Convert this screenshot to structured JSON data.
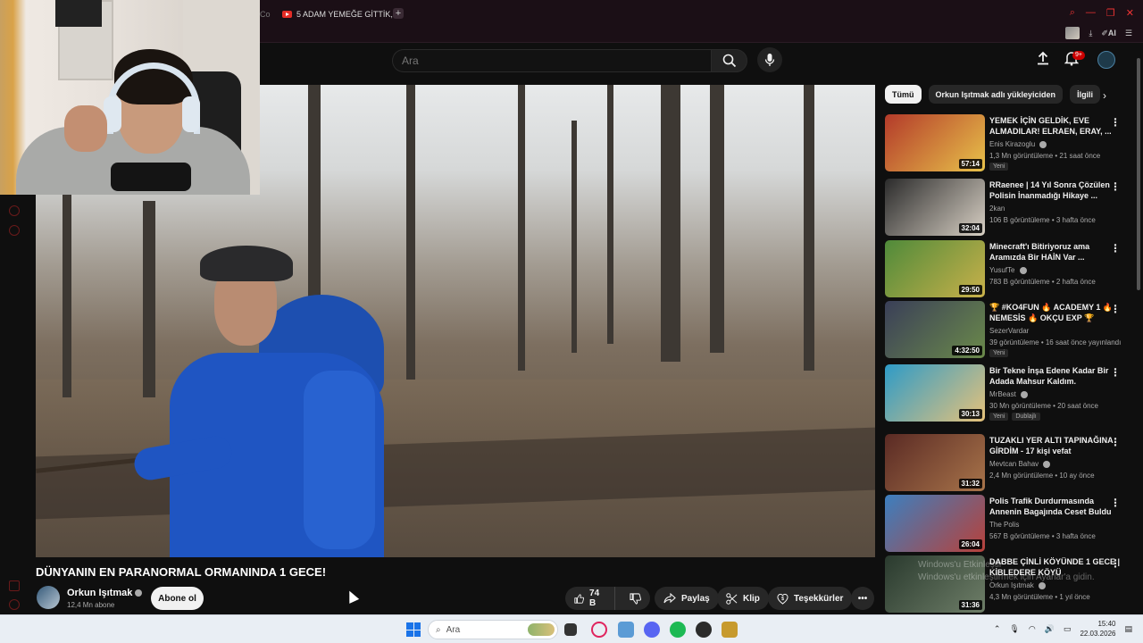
{
  "browser": {
    "tabs": [
      {
        "label": "Co",
        "partial": true
      },
      {
        "label": "5 ADAM YEMEĞE GİTTİK,"
      }
    ],
    "new_tab": "+",
    "toolbar_ai_label": "AI"
  },
  "masthead": {
    "search_placeholder": "Ara",
    "notifications_badge": "9+"
  },
  "video": {
    "title": "DÜNYANIN EN PARANORMAL ORMANINDA 1 GECE!",
    "channel": "Orkun Işıtmak",
    "subscribers": "12,4 Mn abone",
    "subscribe_label": "Abone ol",
    "likes": "74 B",
    "share_label": "Paylaş",
    "clip_label": "Klip",
    "thanks_label": "Teşekkürler"
  },
  "chips": [
    "Tümü",
    "Orkun Işıtmak adlı yükleyiciden",
    "İlgili"
  ],
  "recommendations": [
    {
      "title": "YEMEK İÇİN GELDİK, EVE ALMADILAR! ELRAEN, ERAY, ...",
      "channel": "Enis Kirazoglu",
      "meta": "1,3 Mn görüntüleme • 21 saat önce",
      "badges": [
        "Yeni"
      ],
      "duration": "57:14",
      "thumb_colors": [
        "#b33a2a",
        "#e8c24a"
      ],
      "verified": true
    },
    {
      "title": "RRaenee | 14 Yıl Sonra Çözülen Polisin İnanmadığı Hikaye ...",
      "channel": "2kan",
      "meta": "106 B görüntüleme • 3 hafta önce",
      "badges": [],
      "duration": "32:04",
      "thumb_colors": [
        "#2b2b2b",
        "#d8d0c4"
      ],
      "verified": false
    },
    {
      "title": "Minecraft'ı Bitiriyoruz ama Aramızda Bir HAİN Var ...",
      "channel": "YusufTe",
      "meta": "783 B görüntüleme • 2 hafta önce",
      "badges": [],
      "duration": "29:50",
      "thumb_colors": [
        "#4f8a3a",
        "#c9b14a"
      ],
      "verified": true
    },
    {
      "title": "🏆 #KO4FUN 🔥 ACADEMY 1 🔥 NEMESİS 🔥 OKÇU EXP 🏆",
      "channel": "SezerVardar",
      "meta": "39 görüntüleme • 16 saat önce yayınlandı",
      "badges": [
        "Yeni"
      ],
      "duration": "4:32:50",
      "thumb_colors": [
        "#3a3f58",
        "#6b8a4a"
      ],
      "verified": false
    },
    {
      "title": "Bir Tekne İnşa Edene Kadar Bir Adada Mahsur Kaldım.",
      "channel": "MrBeast",
      "meta": "30 Mn görüntüleme • 20 saat önce",
      "badges": [
        "Yeni",
        "Dublajlı"
      ],
      "duration": "30:13",
      "thumb_colors": [
        "#2e9bc7",
        "#e6c27a"
      ],
      "verified": true
    },
    {
      "title": "TUZAKLI YER ALTI TAPINAĞINA GİRDİM - 17 kişi vefat",
      "channel": "Mevtcan Bahav",
      "meta": "2,4 Mn görüntüleme • 10 ay önce",
      "badges": [],
      "duration": "31:32",
      "thumb_colors": [
        "#5a2a24",
        "#a8744a"
      ],
      "verified": true
    },
    {
      "title": "Polis Trafik Durdurmasında Annenin Bagajında Ceset Buldu",
      "channel": "The Polis",
      "meta": "567 B görüntüleme • 3 hafta önce",
      "badges": [],
      "duration": "26:04",
      "thumb_colors": [
        "#3c7fbf",
        "#b8413a"
      ],
      "verified": false
    },
    {
      "title": "DABBE ÇİNLİ KÖYÜNDE 1 GECE | KİBLEDERE KÖYÜ",
      "channel": "Orkun Işıtmak",
      "meta": "4,3 Mn görüntüleme • 1 yıl önce",
      "badges": [],
      "duration": "31:36",
      "thumb_colors": [
        "#2a3a2e",
        "#6e7e68"
      ],
      "verified": true
    }
  ],
  "watermark": {
    "line1": "Windows'u Etkinleştir",
    "line2": "Windows'u etkinleştirmek için Ayarlar'a gidin."
  },
  "taskbar": {
    "search_label": "Ara",
    "time": "15:40",
    "date": "22.03.2026"
  },
  "colors": {
    "background": "#0f0f0f",
    "accent": "#cc0000",
    "chip_active": "#f1f1f1",
    "taskbar": "#e9eef4"
  }
}
